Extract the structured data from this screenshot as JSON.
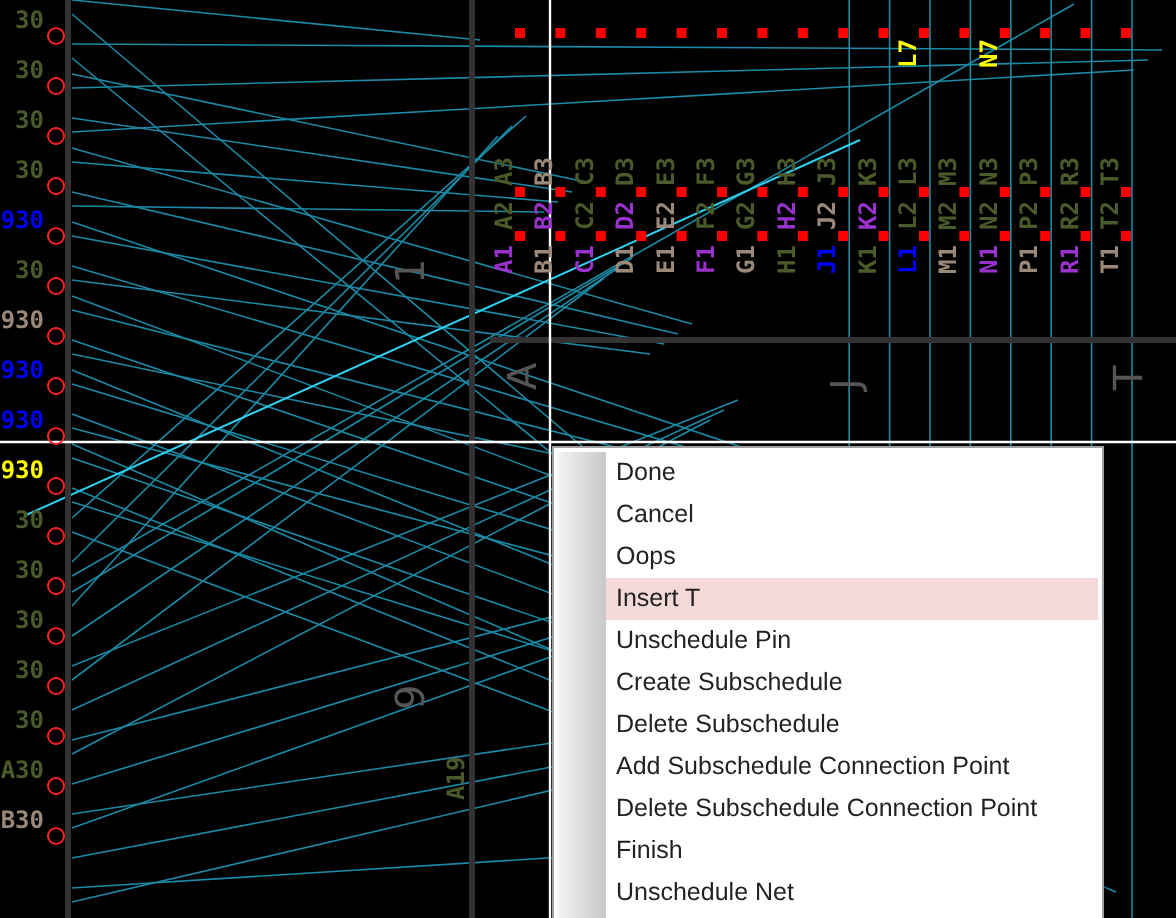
{
  "board": {
    "pin_rows": [
      {
        "labels": [
          {
            "text": "A3",
            "color": "#4b5a2a"
          },
          {
            "text": "B3",
            "color": "#9a8878"
          },
          {
            "text": "C3",
            "color": "#4b5a2a"
          },
          {
            "text": "D3",
            "color": "#4b5a2a"
          },
          {
            "text": "E3",
            "color": "#4b5a2a"
          },
          {
            "text": "F3",
            "color": "#4b5a2a"
          },
          {
            "text": "G3",
            "color": "#4b5a2a"
          },
          {
            "text": "H3",
            "color": "#4b5a2a"
          },
          {
            "text": "J3",
            "color": "#4b5a2a"
          },
          {
            "text": "K3",
            "color": "#4b5a2a"
          },
          {
            "text": "L3",
            "color": "#4b5a2a"
          },
          {
            "text": "M3",
            "color": "#4b5a2a"
          },
          {
            "text": "N3",
            "color": "#4b5a2a"
          },
          {
            "text": "P3",
            "color": "#4b5a2a"
          },
          {
            "text": "R3",
            "color": "#4b5a2a"
          },
          {
            "text": "T3",
            "color": "#4b5a2a"
          }
        ]
      },
      {
        "labels": [
          {
            "text": "A2",
            "color": "#4b5a2a"
          },
          {
            "text": "B2",
            "color": "#9932cc"
          },
          {
            "text": "C2",
            "color": "#4b5a2a"
          },
          {
            "text": "D2",
            "color": "#9932cc"
          },
          {
            "text": "E2",
            "color": "#9a8878"
          },
          {
            "text": "F2",
            "color": "#4b5a2a"
          },
          {
            "text": "G2",
            "color": "#4b5a2a"
          },
          {
            "text": "H2",
            "color": "#9932cc"
          },
          {
            "text": "J2",
            "color": "#9a8878"
          },
          {
            "text": "K2",
            "color": "#9932cc"
          },
          {
            "text": "L2",
            "color": "#4b5a2a"
          },
          {
            "text": "M2",
            "color": "#4b5a2a"
          },
          {
            "text": "N2",
            "color": "#4b5a2a"
          },
          {
            "text": "P2",
            "color": "#4b5a2a"
          },
          {
            "text": "R2",
            "color": "#4b5a2a"
          },
          {
            "text": "T2",
            "color": "#4b5a2a"
          }
        ]
      },
      {
        "labels": [
          {
            "text": "A1",
            "color": "#9932cc"
          },
          {
            "text": "B1",
            "color": "#9a8878"
          },
          {
            "text": "C1",
            "color": "#9932cc"
          },
          {
            "text": "D1",
            "color": "#9a8878"
          },
          {
            "text": "E1",
            "color": "#9a8878"
          },
          {
            "text": "F1",
            "color": "#9932cc"
          },
          {
            "text": "G1",
            "color": "#9a8878"
          },
          {
            "text": "H1",
            "color": "#4b5a2a"
          },
          {
            "text": "J1",
            "color": "#0000ff"
          },
          {
            "text": "K1",
            "color": "#4b5a2a"
          },
          {
            "text": "L1",
            "color": "#0000ff"
          },
          {
            "text": "M1",
            "color": "#9a8878"
          },
          {
            "text": "N1",
            "color": "#9932cc"
          },
          {
            "text": "P1",
            "color": "#9a8878"
          },
          {
            "text": "R1",
            "color": "#9932cc"
          },
          {
            "text": "T1",
            "color": "#9a8878"
          }
        ]
      }
    ],
    "top_row": [
      {
        "text": "L7",
        "color": "#ffff00"
      },
      {
        "text": "N7",
        "color": "#ffff00"
      }
    ],
    "axis_labels": [
      {
        "text": "A"
      },
      {
        "text": "J"
      },
      {
        "text": "T"
      }
    ],
    "row_marks": [
      {
        "text": "1"
      },
      {
        "text": "9"
      }
    ],
    "left_pins": [
      {
        "text": "30",
        "color": "#4b5a2a"
      },
      {
        "text": "30",
        "color": "#4b5a2a"
      },
      {
        "text": "30",
        "color": "#4b5a2a"
      },
      {
        "text": "30",
        "color": "#4b5a2a"
      },
      {
        "text": "930",
        "color": "#0000ff"
      },
      {
        "text": "30",
        "color": "#4b5a2a"
      },
      {
        "text": "930",
        "color": "#9a8878"
      },
      {
        "text": "930",
        "color": "#0000ff"
      },
      {
        "text": "930",
        "color": "#0000ff"
      },
      {
        "text": "930",
        "color": "#ffff00"
      },
      {
        "text": "30",
        "color": "#4b5a2a"
      },
      {
        "text": "30",
        "color": "#4b5a2a"
      },
      {
        "text": "30",
        "color": "#4b5a2a"
      },
      {
        "text": "30",
        "color": "#4b5a2a"
      },
      {
        "text": "30",
        "color": "#4b5a2a"
      },
      {
        "text": "A30",
        "color": "#4b5a2a"
      },
      {
        "text": "B30",
        "color": "#9a8878"
      }
    ],
    "lower_label": "A19"
  },
  "context_menu": {
    "items": [
      {
        "label": "Done",
        "selected": false
      },
      {
        "label": "Cancel",
        "selected": false
      },
      {
        "label": "Oops",
        "selected": false
      },
      {
        "label": "Insert T",
        "selected": true
      },
      {
        "label": "Unschedule Pin",
        "selected": false
      },
      {
        "label": "Create Subschedule",
        "selected": false
      },
      {
        "label": "Delete Subschedule",
        "selected": false
      },
      {
        "label": "Add Subschedule Connection Point",
        "selected": false
      },
      {
        "label": "Delete Subschedule Connection Point",
        "selected": false
      },
      {
        "label": "Finish",
        "selected": false
      },
      {
        "label": "Unschedule Net",
        "selected": false
      }
    ]
  }
}
